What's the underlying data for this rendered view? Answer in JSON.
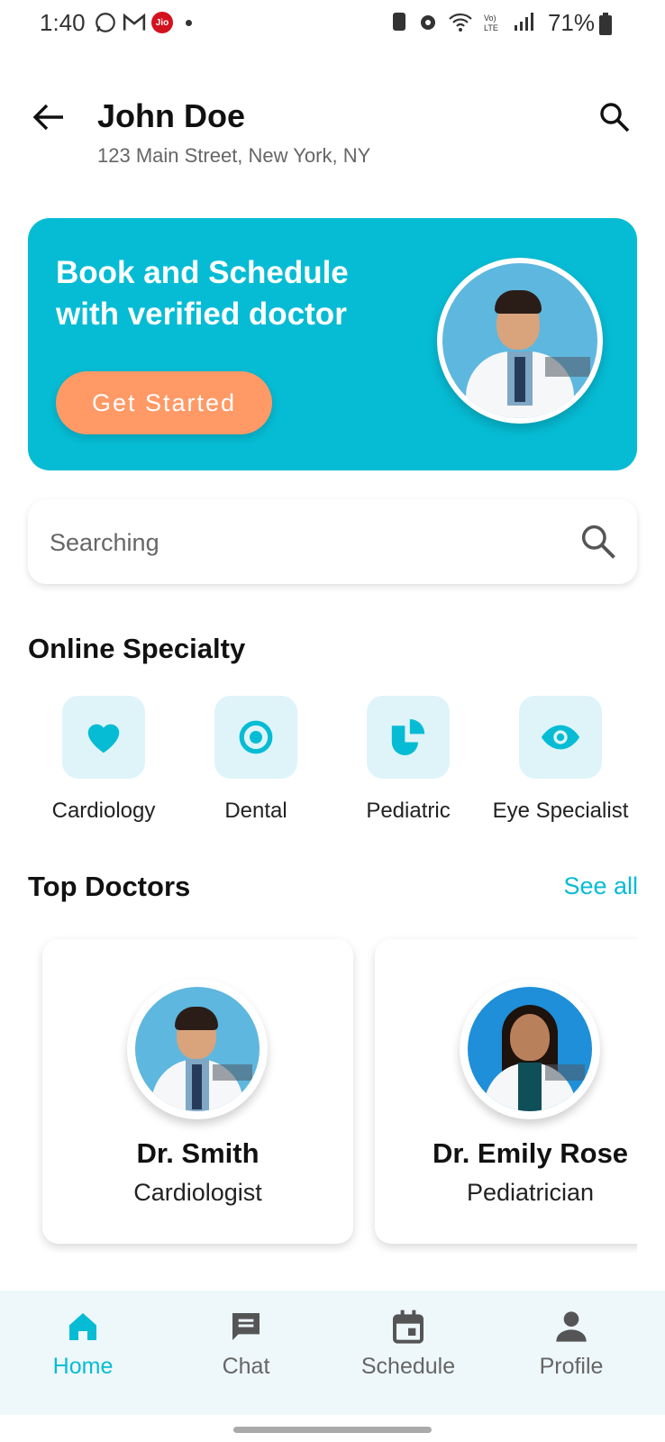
{
  "status": {
    "time": "1:40",
    "battery": "71%",
    "carrier_badge": "Jio"
  },
  "header": {
    "name": "John Doe",
    "address": "123 Main Street, New York, NY"
  },
  "banner": {
    "title": "Book and Schedule with verified doctor",
    "cta_label": "Get Started"
  },
  "search": {
    "placeholder": "Searching"
  },
  "specialty": {
    "title": "Online Specialty",
    "items": [
      {
        "label": "Cardiology",
        "icon": "heart-icon"
      },
      {
        "label": "Dental",
        "icon": "target-icon"
      },
      {
        "label": "Pediatric",
        "icon": "pie-chart-icon"
      },
      {
        "label": "Eye Specialist",
        "icon": "eye-icon"
      }
    ]
  },
  "top_doctors": {
    "title": "Top Doctors",
    "see_all": "See all",
    "doctors": [
      {
        "name": "Dr. Smith",
        "specialty": "Cardiologist"
      },
      {
        "name": "Dr. Emily Rose",
        "specialty": "Pediatrician"
      }
    ]
  },
  "nav": {
    "items": [
      {
        "label": "Home",
        "icon": "home-icon",
        "active": true
      },
      {
        "label": "Chat",
        "icon": "chat-icon",
        "active": false
      },
      {
        "label": "Schedule",
        "icon": "calendar-icon",
        "active": false
      },
      {
        "label": "Profile",
        "icon": "person-icon",
        "active": false
      }
    ]
  },
  "colors": {
    "accent": "#06bcd4",
    "cta": "#ff9966",
    "tile": "#dff4f8",
    "nav_bg": "#eef8fb"
  }
}
